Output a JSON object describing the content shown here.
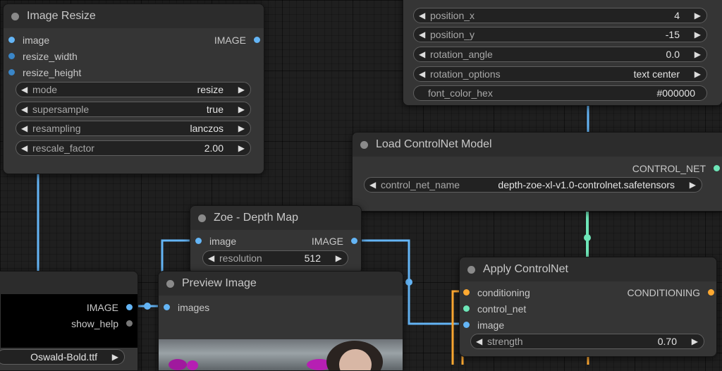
{
  "image_resize": {
    "title": "Image Resize",
    "inputs": [
      "image",
      "resize_width",
      "resize_height"
    ],
    "output": "IMAGE",
    "widgets": [
      {
        "label": "mode",
        "value": "resize"
      },
      {
        "label": "supersample",
        "value": "true"
      },
      {
        "label": "resampling",
        "value": "lanczos"
      },
      {
        "label": "rescale_factor",
        "value": "2.00"
      }
    ]
  },
  "text_overlay": {
    "widgets": [
      {
        "label": "position_x",
        "value": "4"
      },
      {
        "label": "position_y",
        "value": "-15"
      },
      {
        "label": "rotation_angle",
        "value": "0.0"
      },
      {
        "label": "rotation_options",
        "value": "text center"
      },
      {
        "label": "font_color_hex",
        "value": "#000000"
      }
    ]
  },
  "load_controlnet": {
    "title": "Load ControlNet Model",
    "output": "CONTROL_NET",
    "widget": {
      "label": "control_net_name",
      "value": "depth-zoe-xl-v1.0-controlnet.safetensors"
    }
  },
  "zoe_depth": {
    "title": "Zoe - Depth Map",
    "input": "image",
    "output": "IMAGE",
    "widget": {
      "label": "resolution",
      "value": "512"
    }
  },
  "preview_image": {
    "title": "Preview Image",
    "input": "images"
  },
  "apply_controlnet": {
    "title": "Apply ControlNet",
    "inputs": [
      "conditioning",
      "control_net",
      "image"
    ],
    "output": "CONDITIONING",
    "widget": {
      "label": "strength",
      "value": "0.70"
    }
  },
  "left_node": {
    "outputs": [
      "IMAGE",
      "show_help"
    ],
    "font_widget_value": "Oswald-Bold.ttf"
  },
  "colors": {
    "image_link": "#64b5f6",
    "control_net_link": "#6ee6b8",
    "conditioning_link": "#ffa931",
    "inactive_port": "#777777",
    "canvas": "#1f1f1f",
    "node_body": "#353535",
    "node_title": "#2c2c2c"
  }
}
